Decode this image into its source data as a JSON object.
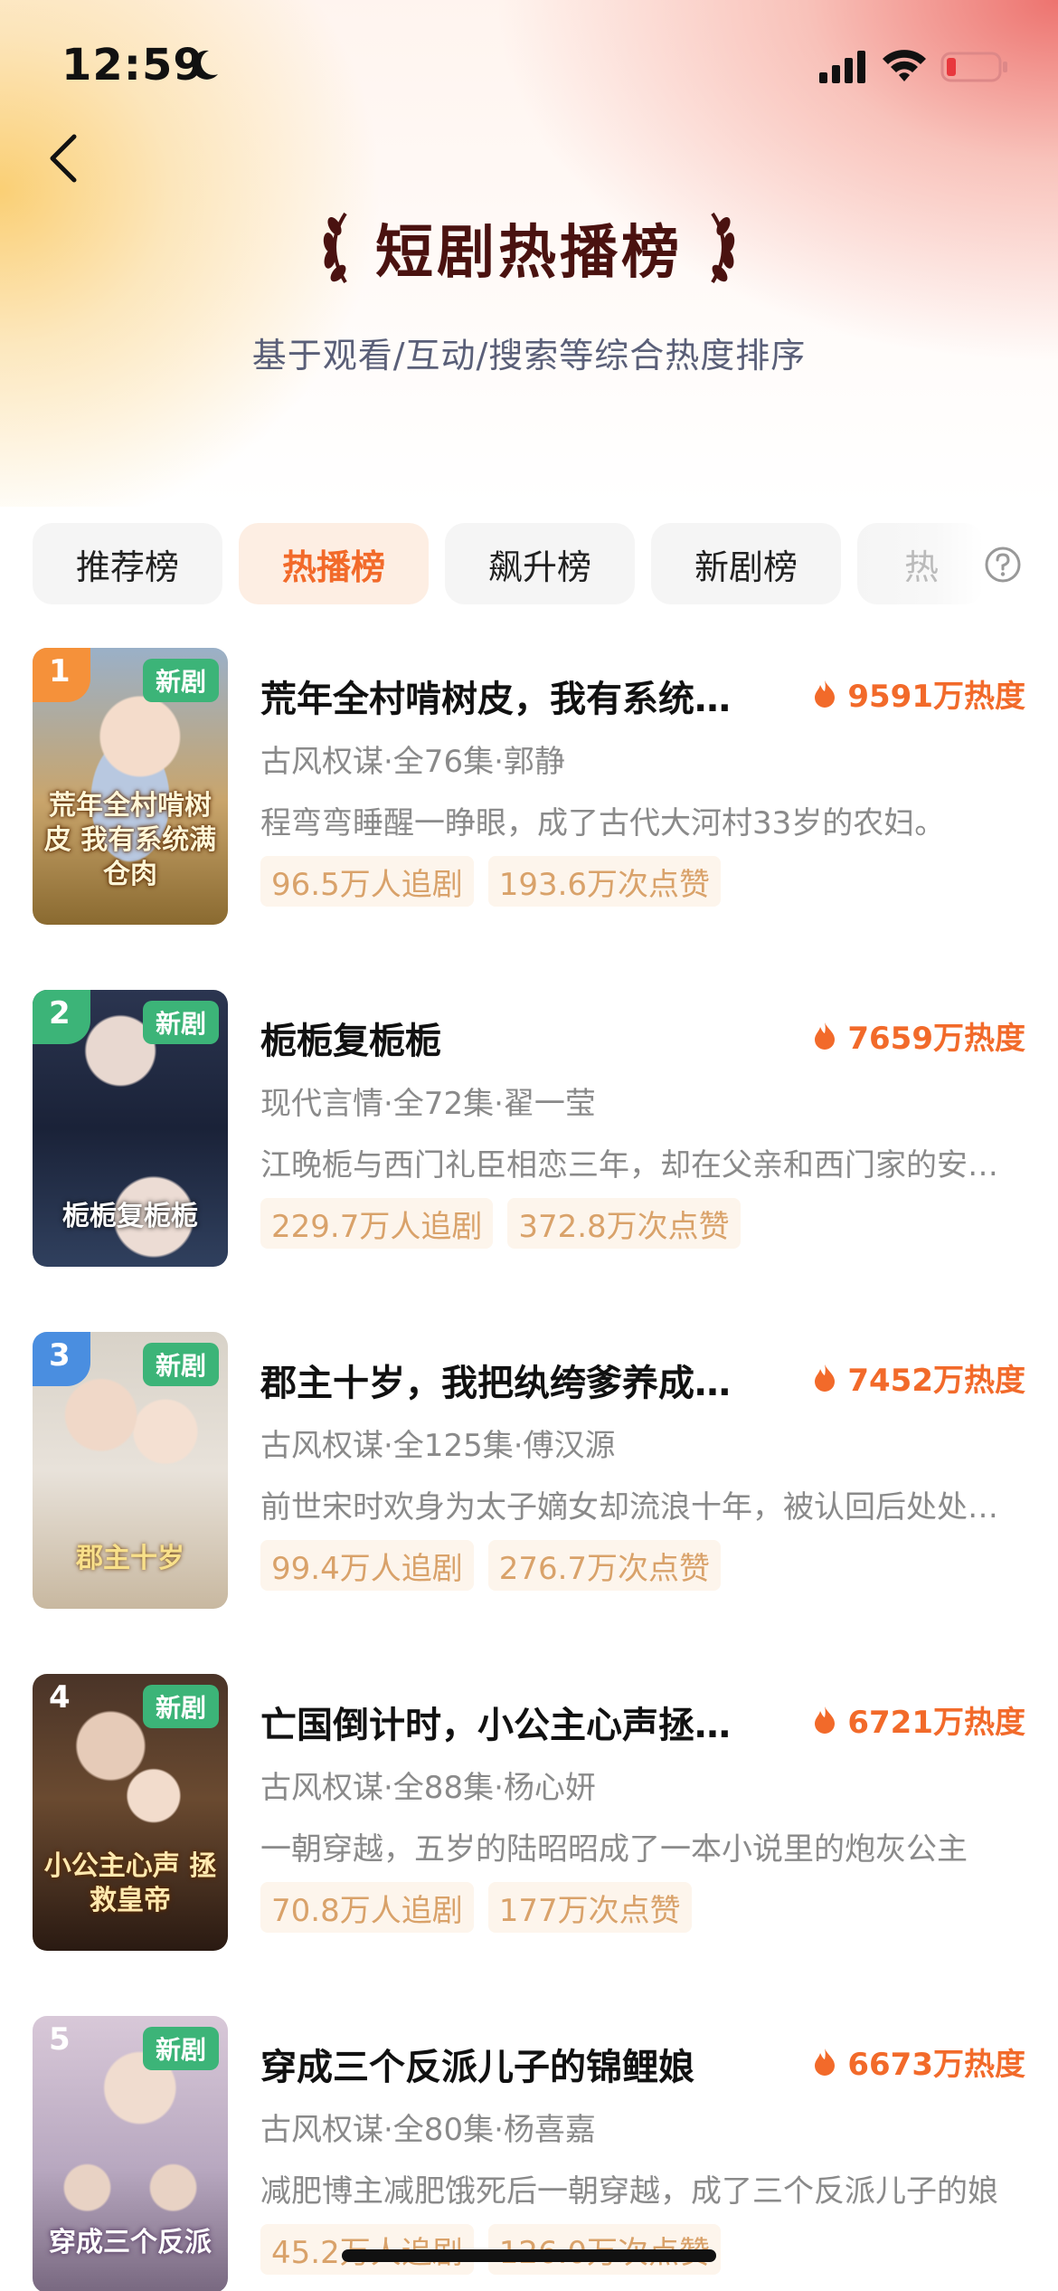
{
  "status_bar": {
    "time": "12:59"
  },
  "header": {
    "title": "短剧热播榜",
    "subtitle": "基于观看/互动/搜索等综合热度排序"
  },
  "tabs": [
    {
      "label": "推荐榜",
      "active": false
    },
    {
      "label": "热播榜",
      "active": true
    },
    {
      "label": "飙升榜",
      "active": false
    },
    {
      "label": "新剧榜",
      "active": false
    },
    {
      "label": "热",
      "active": false
    }
  ],
  "colors": {
    "accent": "#f26a2a",
    "new_tag": "#3cb478",
    "stat_text": "#d9a26a",
    "stat_bg": "#fdf5ec",
    "title_dark": "#4a1210"
  },
  "dramas": [
    {
      "rank": "1",
      "new_tag": "新剧",
      "title": "荒年全村啃树皮，我有系统满仓肉",
      "heat": "9591万热度",
      "meta": "古风权谋·全76集·郭静",
      "desc": "程弯弯睡醒一睁眼，成了古代大河村33岁的农妇。",
      "followers": "96.5万人追剧",
      "likes": "193.6万次点赞",
      "poster_text": "荒年全村啃树皮 我有系统满仓肉"
    },
    {
      "rank": "2",
      "new_tag": "新剧",
      "title": "栀栀复栀栀",
      "heat": "7659万热度",
      "meta": "现代言情·全72集·翟一莹",
      "desc": "江晚栀与西门礼臣相恋三年，却在父亲和西门家的安排下",
      "followers": "229.7万人追剧",
      "likes": "372.8万次点赞",
      "poster_text": "栀栀复栀栀"
    },
    {
      "rank": "3",
      "new_tag": "新剧",
      "title": "郡主十岁，我把纨绔爹养成皇帝",
      "heat": "7452万热度",
      "meta": "古风权谋·全125集·傅汉源",
      "desc": "前世宋时欢身为太子嫡女却流浪十年，被认回后处处受欺",
      "followers": "99.4万人追剧",
      "likes": "276.7万次点赞",
      "poster_text": "郡主十岁"
    },
    {
      "rank": "4",
      "new_tag": "新剧",
      "title": "亡国倒计时，小公主心声拯救皇帝",
      "heat": "6721万热度",
      "meta": "古风权谋·全88集·杨心妍",
      "desc": "一朝穿越，五岁的陆昭昭成了一本小说里的炮灰公主",
      "followers": "70.8万人追剧",
      "likes": "177万次点赞",
      "poster_text": "小公主心声 拯救皇帝"
    },
    {
      "rank": "5",
      "new_tag": "新剧",
      "title": "穿成三个反派儿子的锦鲤娘",
      "heat": "6673万热度",
      "meta": "古风权谋·全80集·杨喜嘉",
      "desc": "减肥博主减肥饿死后一朝穿越，成了三个反派儿子的娘",
      "followers": "45.2万人追剧",
      "likes": "126.0万次点赞",
      "poster_text": "穿成三个反派"
    }
  ]
}
